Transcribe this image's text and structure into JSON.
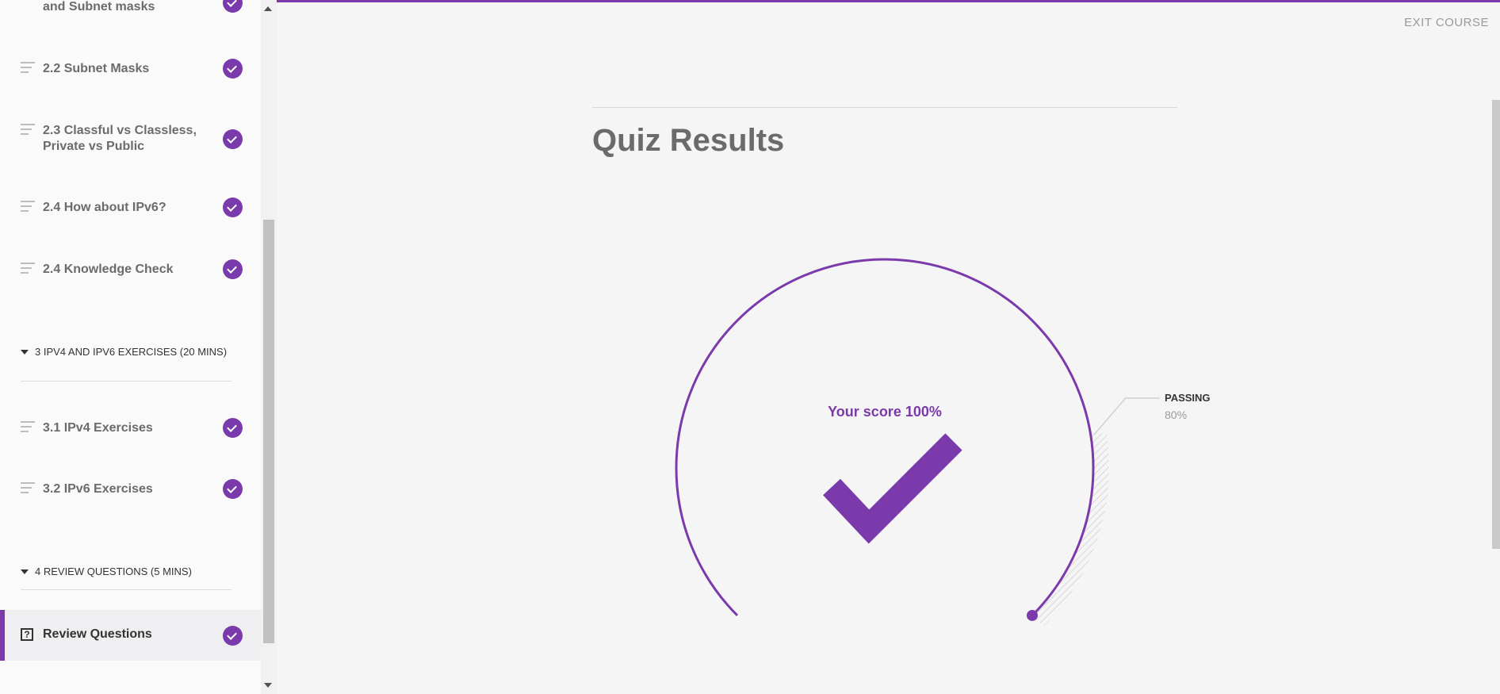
{
  "sidebar": {
    "lessons_top": [
      {
        "label": "and Subnet masks",
        "completed": true
      },
      {
        "label": "2.2 Subnet Masks",
        "completed": true
      },
      {
        "label": "2.3 Classful vs Classless, Private vs Public",
        "completed": true
      },
      {
        "label": "2.4 How about IPv6?",
        "completed": true
      },
      {
        "label": "2.4 Knowledge Check",
        "completed": true
      }
    ],
    "section3": {
      "title": "3 IPV4 AND IPV6 EXERCISES (20 MINS)"
    },
    "lessons_s3": [
      {
        "label": "3.1 IPv4 Exercises",
        "completed": true
      },
      {
        "label": "3.2 IPv6 Exercises",
        "completed": true
      }
    ],
    "section4": {
      "title": "4 REVIEW QUESTIONS (5 MINS)"
    },
    "active_lesson": {
      "label": "Review Questions",
      "completed": true,
      "icon": "question-box-icon"
    }
  },
  "header": {
    "exit_label": "EXIT COURSE"
  },
  "main": {
    "title": "Quiz Results",
    "score_text": "Your score 100%",
    "score_percent": 100,
    "passing_label": "PASSING",
    "passing_value": "80%",
    "passing_percent": 80
  },
  "colors": {
    "accent": "#7b3aab",
    "text": "#6b6b6b",
    "background": "#f5f5f6"
  }
}
